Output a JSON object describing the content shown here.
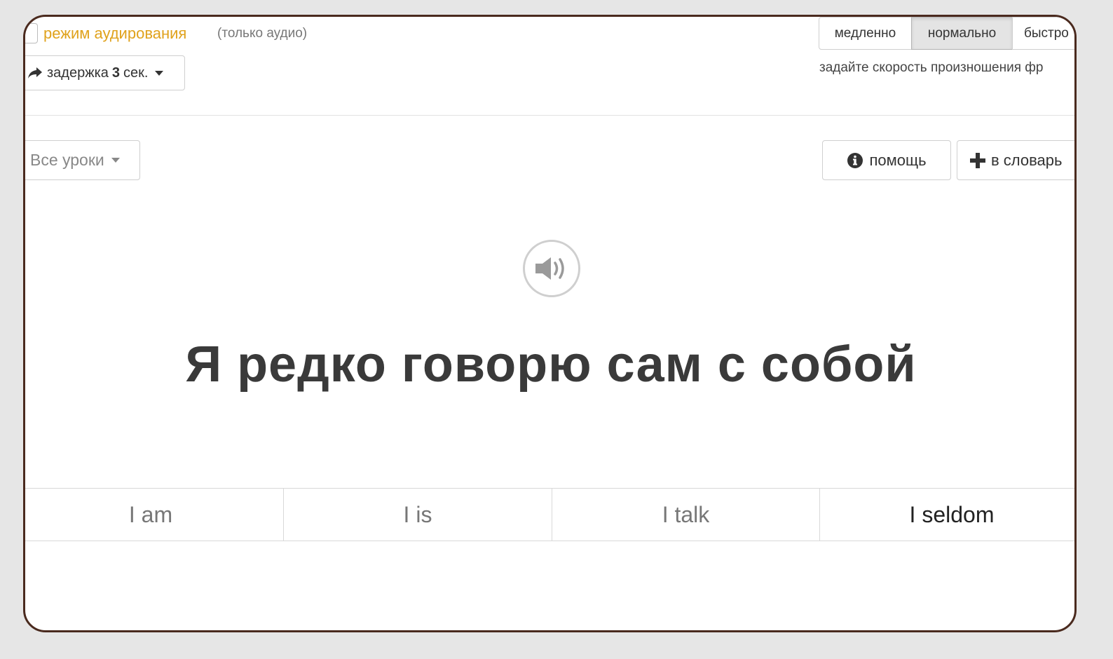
{
  "listening_mode": {
    "label": "режим аудирования",
    "hint": "(только аудио)",
    "checked": false
  },
  "delay": {
    "prefix": "задержка",
    "value": "3",
    "unit": "сек."
  },
  "speed": {
    "options": [
      "медленно",
      "нормально",
      "быстро"
    ],
    "selected": "нормально",
    "hint": "задайте скорость произношения фр"
  },
  "lessons": {
    "label": "Все уроки"
  },
  "buttons": {
    "help": "помощь",
    "add_to_dictionary": "в словарь"
  },
  "phrase": "Я редко говорю сам с собой",
  "answers": [
    "I am",
    "I is",
    "I talk",
    "I seldom"
  ],
  "colors": {
    "accent": "#e0a21c",
    "frame": "#4a2a1e",
    "text": "#3a3a3a"
  }
}
